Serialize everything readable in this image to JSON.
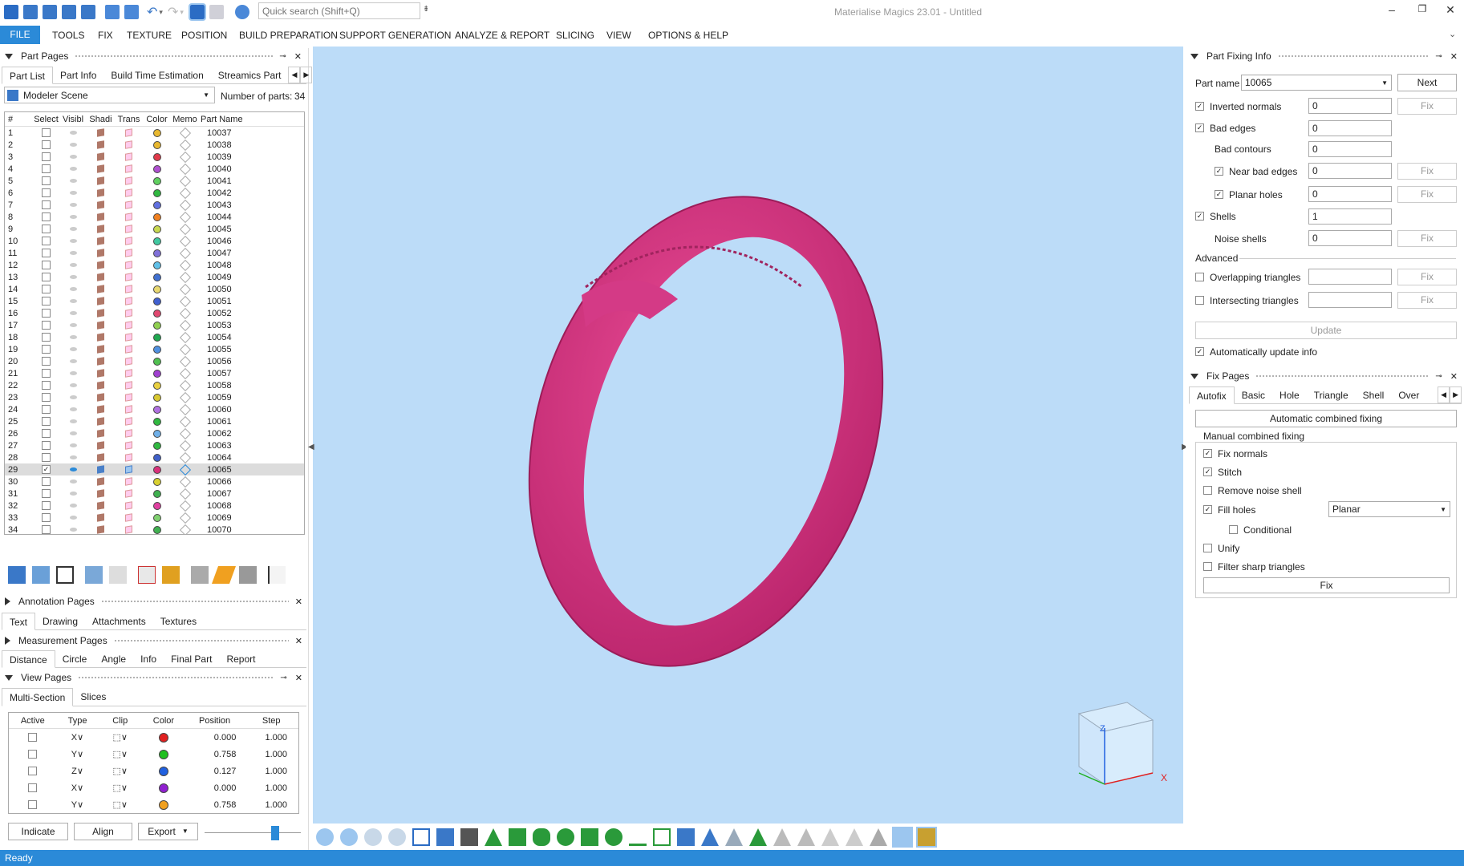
{
  "titlebar": {
    "search_placeholder": "Quick search (Shift+Q)",
    "app_title": "Materialise Magics 23.01 - Untitled"
  },
  "menu": [
    "FILE",
    "TOOLS",
    "FIX",
    "TEXTURE",
    "POSITION",
    "BUILD PREPARATION",
    "SUPPORT GENERATION",
    "ANALYZE & REPORT",
    "SLICING",
    "VIEW",
    "OPTIONS & HELP"
  ],
  "part_pages": {
    "title": "Part Pages",
    "tabs": [
      "Part List",
      "Part Info",
      "Build Time Estimation",
      "Streamics Part"
    ],
    "scene": "Modeler Scene",
    "num_parts_label": "Number of parts:",
    "num_parts": "34",
    "columns": [
      "#",
      "Select",
      "Visibl",
      "Shadi",
      "Trans",
      "Color",
      "Memo",
      "Part Name"
    ],
    "rows": [
      {
        "n": "1",
        "name": "10037",
        "color": "#e8b830",
        "sel": false
      },
      {
        "n": "2",
        "name": "10038",
        "color": "#e8b830",
        "sel": false
      },
      {
        "n": "3",
        "name": "10039",
        "color": "#e03a4a",
        "sel": false
      },
      {
        "n": "4",
        "name": "10040",
        "color": "#b050d0",
        "sel": false
      },
      {
        "n": "5",
        "name": "10041",
        "color": "#60d060",
        "sel": false
      },
      {
        "n": "6",
        "name": "10042",
        "color": "#30b840",
        "sel": false
      },
      {
        "n": "7",
        "name": "10043",
        "color": "#6070e0",
        "sel": false
      },
      {
        "n": "8",
        "name": "10044",
        "color": "#f08020",
        "sel": false
      },
      {
        "n": "9",
        "name": "10045",
        "color": "#c8d850",
        "sel": false
      },
      {
        "n": "10",
        "name": "10046",
        "color": "#40c8a0",
        "sel": false
      },
      {
        "n": "11",
        "name": "10047",
        "color": "#8070d8",
        "sel": false
      },
      {
        "n": "12",
        "name": "10048",
        "color": "#60c0e8",
        "sel": false
      },
      {
        "n": "13",
        "name": "10049",
        "color": "#4070d0",
        "sel": false
      },
      {
        "n": "14",
        "name": "10050",
        "color": "#e8d870",
        "sel": false
      },
      {
        "n": "15",
        "name": "10051",
        "color": "#4060d0",
        "sel": false
      },
      {
        "n": "16",
        "name": "10052",
        "color": "#e04870",
        "sel": false
      },
      {
        "n": "17",
        "name": "10053",
        "color": "#90d050",
        "sel": false
      },
      {
        "n": "18",
        "name": "10054",
        "color": "#20a850",
        "sel": false
      },
      {
        "n": "19",
        "name": "10055",
        "color": "#5090e0",
        "sel": false
      },
      {
        "n": "20",
        "name": "10056",
        "color": "#50c050",
        "sel": false
      },
      {
        "n": "21",
        "name": "10057",
        "color": "#a040d0",
        "sel": false
      },
      {
        "n": "22",
        "name": "10058",
        "color": "#e8d040",
        "sel": false
      },
      {
        "n": "23",
        "name": "10059",
        "color": "#d8c830",
        "sel": false
      },
      {
        "n": "24",
        "name": "10060",
        "color": "#b070e0",
        "sel": false
      },
      {
        "n": "25",
        "name": "10061",
        "color": "#30b840",
        "sel": false
      },
      {
        "n": "26",
        "name": "10062",
        "color": "#70b0e8",
        "sel": false
      },
      {
        "n": "27",
        "name": "10063",
        "color": "#30b840",
        "sel": false
      },
      {
        "n": "28",
        "name": "10064",
        "color": "#4060c8",
        "sel": false
      },
      {
        "n": "29",
        "name": "10065",
        "color": "#d8307a",
        "sel": true
      },
      {
        "n": "30",
        "name": "10066",
        "color": "#d8d030",
        "sel": false
      },
      {
        "n": "31",
        "name": "10067",
        "color": "#40b050",
        "sel": false
      },
      {
        "n": "32",
        "name": "10068",
        "color": "#e040a0",
        "sel": false
      },
      {
        "n": "33",
        "name": "10069",
        "color": "#80d070",
        "sel": false
      },
      {
        "n": "34",
        "name": "10070",
        "color": "#40b050",
        "sel": false
      }
    ]
  },
  "annotation_pages": {
    "title": "Annotation Pages",
    "tabs": [
      "Text",
      "Drawing",
      "Attachments",
      "Textures"
    ]
  },
  "measurement_pages": {
    "title": "Measurement Pages",
    "tabs": [
      "Distance",
      "Circle",
      "Angle",
      "Info",
      "Final Part",
      "Report"
    ]
  },
  "view_pages": {
    "title": "View Pages",
    "tabs": [
      "Multi-Section",
      "Slices"
    ],
    "columns": [
      "Active",
      "Type",
      "Clip",
      "Color",
      "Position",
      "Step"
    ],
    "rows": [
      {
        "type": "X",
        "color": "#e02020",
        "position": "0.000",
        "step": "1.000"
      },
      {
        "type": "Y",
        "color": "#20c020",
        "position": "0.758",
        "step": "1.000"
      },
      {
        "type": "Z",
        "color": "#2060e0",
        "position": "0.127",
        "step": "1.000"
      },
      {
        "type": "X",
        "color": "#9020d0",
        "position": "0.000",
        "step": "1.000"
      },
      {
        "type": "Y",
        "color": "#f0a020",
        "position": "0.758",
        "step": "1.000"
      }
    ],
    "buttons": {
      "indicate": "Indicate",
      "align": "Align",
      "export": "Export"
    }
  },
  "part_fixing_info": {
    "title": "Part Fixing Info",
    "part_name_label": "Part name",
    "part_name": "10065",
    "next": "Next",
    "inverted_normals": {
      "label": "Inverted normals",
      "value": "0",
      "fix": "Fix"
    },
    "bad_edges": {
      "label": "Bad edges",
      "value": "0"
    },
    "bad_contours": {
      "label": "Bad contours",
      "value": "0"
    },
    "near_bad_edges": {
      "label": "Near bad edges",
      "value": "0",
      "fix": "Fix"
    },
    "planar_holes": {
      "label": "Planar holes",
      "value": "0",
      "fix": "Fix"
    },
    "shells": {
      "label": "Shells",
      "value": "1"
    },
    "noise_shells": {
      "label": "Noise shells",
      "value": "0",
      "fix": "Fix"
    },
    "advanced": "Advanced",
    "overlapping": {
      "label": "Overlapping triangles",
      "value": "",
      "fix": "Fix"
    },
    "intersecting": {
      "label": "Intersecting triangles",
      "value": "",
      "fix": "Fix"
    },
    "update": "Update",
    "auto_update": "Automatically update info"
  },
  "fix_pages": {
    "title": "Fix Pages",
    "tabs": [
      "Autofix",
      "Basic",
      "Hole",
      "Triangle",
      "Shell",
      "Overla"
    ],
    "auto_combined": "Automatic combined fixing",
    "manual_group": "Manual combined fixing",
    "fix_normals": "Fix normals",
    "stitch": "Stitch",
    "remove_noise": "Remove noise shell",
    "fill_holes": "Fill holes",
    "fill_mode": "Planar",
    "conditional": "Conditional",
    "unify": "Unify",
    "filter_sharp": "Filter sharp triangles",
    "fix": "Fix"
  },
  "status": "Ready"
}
